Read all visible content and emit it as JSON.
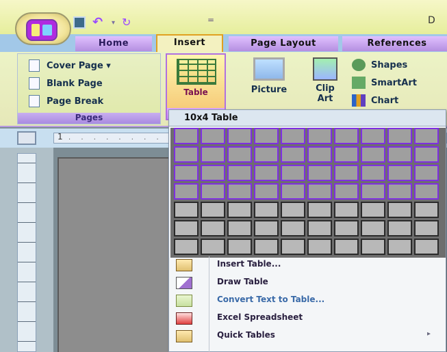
{
  "window": {
    "doc_title": "D",
    "qat_customize": "="
  },
  "tabs": [
    {
      "label": "Home"
    },
    {
      "label": "Insert",
      "selected": true
    },
    {
      "label": "Page Layout"
    },
    {
      "label": "References"
    }
  ],
  "ribbon": {
    "pages_group": {
      "label": "Pages",
      "items": [
        {
          "label": "Cover Page ▾",
          "icon": "cover-page-icon"
        },
        {
          "label": "Blank Page",
          "icon": "blank-page-icon"
        },
        {
          "label": "Page Break",
          "icon": "page-break-icon"
        }
      ]
    },
    "table_button": {
      "label": "Table",
      "dropdown": "▾"
    },
    "picture_button": {
      "label": "Picture"
    },
    "clip_art_button": {
      "label_line1": "Clip",
      "label_line2": "Art"
    },
    "illustrations": [
      {
        "label": "Shapes",
        "icon": "shapes-icon"
      },
      {
        "label": "SmartArt",
        "icon": "smartart-icon"
      },
      {
        "label": "Chart",
        "icon": "chart-icon"
      }
    ]
  },
  "ruler": {
    "first_mark": "1",
    "ticks": "· · · · · · · ·"
  },
  "table_menu": {
    "header": "10x4 Table",
    "grid_columns": 10,
    "grid_rows": 7,
    "selected_columns": 10,
    "selected_rows": 4,
    "items": [
      {
        "label": "Insert Table...",
        "icon": "insert-table-icon"
      },
      {
        "label": "Draw Table",
        "icon": "draw-table-icon"
      },
      {
        "label": "Convert Text to Table...",
        "icon": "convert-text-icon"
      },
      {
        "label": "Excel Spreadsheet",
        "icon": "excel-spreadsheet-icon"
      },
      {
        "label": "Quick Tables",
        "icon": "quick-tables-icon",
        "submenu": "▸"
      }
    ]
  },
  "colors": {
    "selection_border": "#7e2fe0",
    "tab_active_border": "#e0a020",
    "ribbon_bg": "#ecf3c6"
  }
}
